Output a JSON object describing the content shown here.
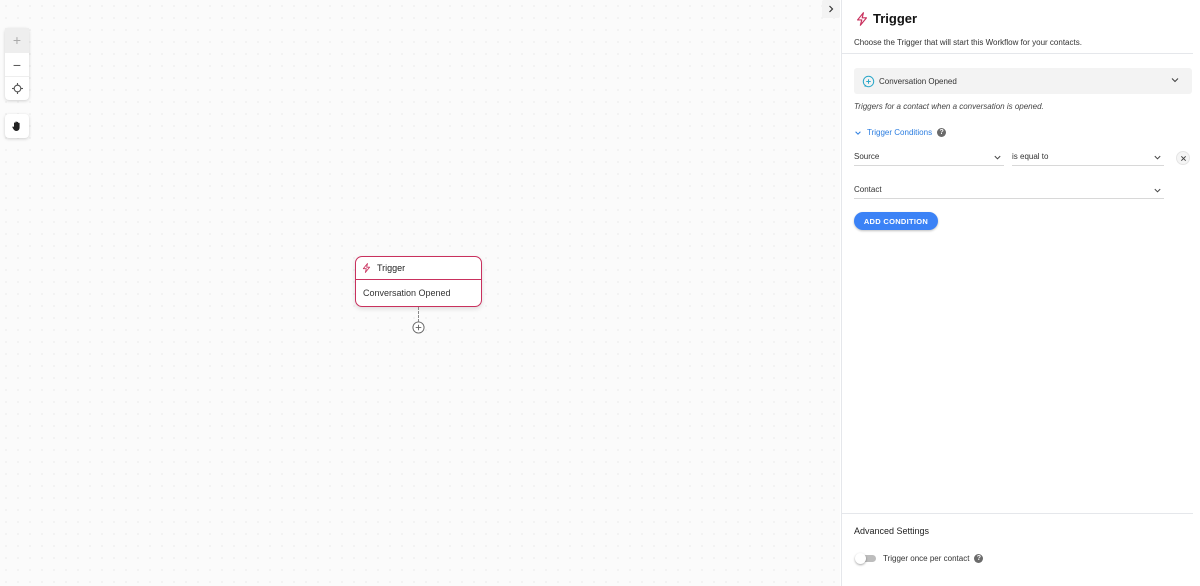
{
  "canvas": {
    "zoom_in_label": "+",
    "zoom_out_label": "−",
    "node": {
      "title": "Trigger",
      "body": "Conversation Opened"
    }
  },
  "panel": {
    "title": "Trigger",
    "subtitle": "Choose the Trigger that will start this Workflow for your contacts.",
    "trigger_select_value": "Conversation Opened",
    "trigger_description": "Triggers for a contact when a conversation is opened.",
    "conditions_label": "Trigger Conditions",
    "condition_field": "Source",
    "condition_operator": "is equal to",
    "condition_value": "Contact",
    "add_condition_label": "ADD CONDITION",
    "advanced_title": "Advanced Settings",
    "trigger_once_label": "Trigger once per contact"
  },
  "colors": {
    "accent": "#3b82f6",
    "node_border": "#c9315e",
    "link": "#2b7de0"
  },
  "icons": [
    "bolt-icon",
    "chat-icon",
    "chevron-down-icon",
    "crosshair-icon",
    "hand-icon",
    "close-icon",
    "help-icon",
    "plus-circle-icon",
    "chevron-right-icon"
  ]
}
